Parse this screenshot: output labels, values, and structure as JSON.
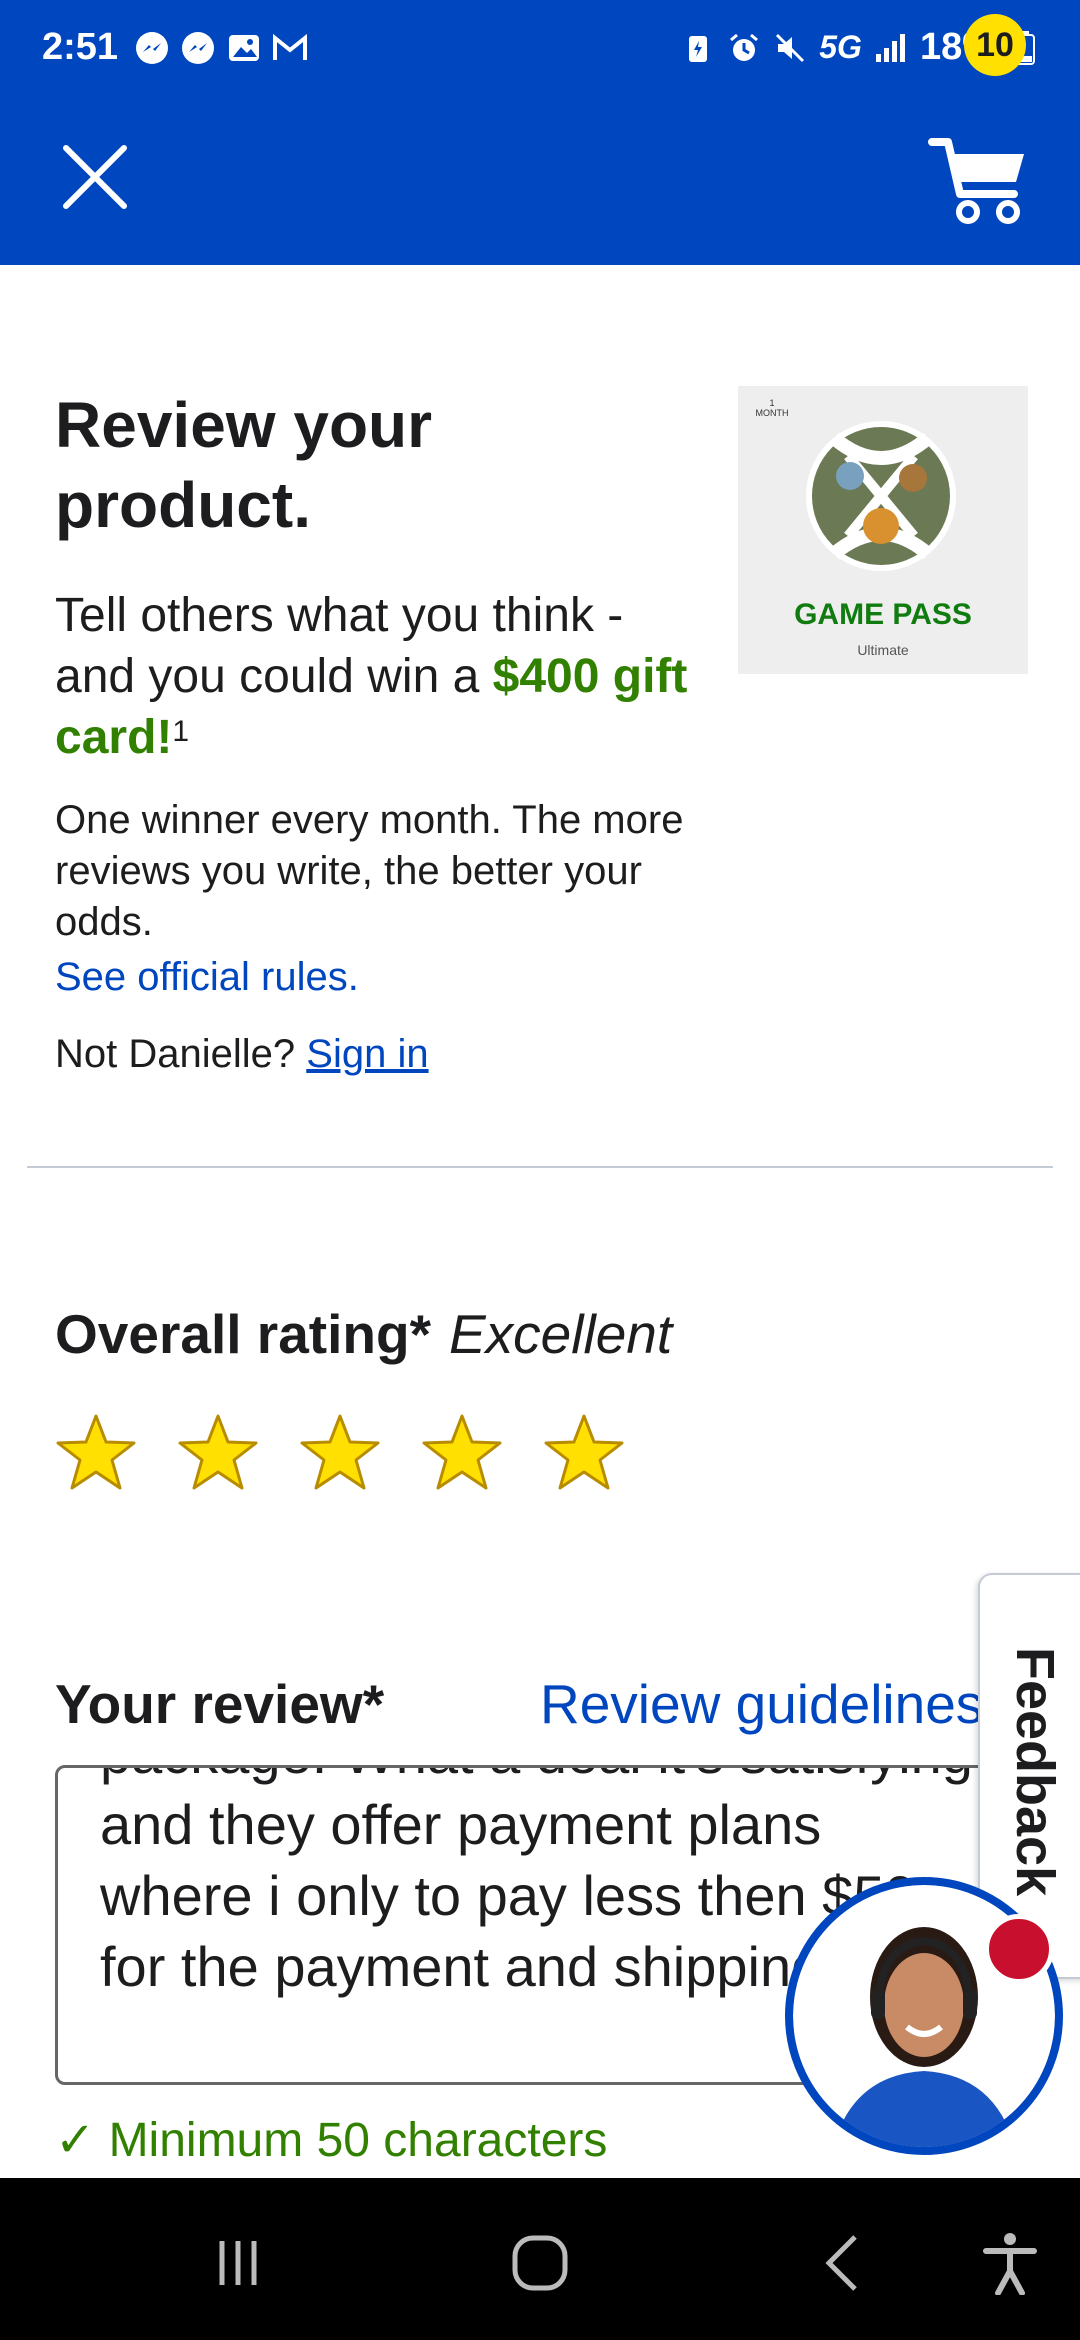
{
  "status_bar": {
    "time": "2:51",
    "notification_icons": [
      "messenger-icon",
      "messenger-icon",
      "gallery-icon",
      "gmail-icon"
    ],
    "system_icons": [
      "battery-saver-icon",
      "alarm-icon",
      "mute-icon",
      "5g-icon",
      "signal-icon"
    ],
    "network": "5G",
    "battery": "18%"
  },
  "app_bar": {
    "close_icon": "close-icon",
    "cart_icon": "cart-icon",
    "cart_count": "10"
  },
  "hero": {
    "title": "Review your product.",
    "subtitle_prefix": "Tell others what you think - and you could win a ",
    "subtitle_highlight": "$400 gift card!",
    "subtitle_sup": "1",
    "note": "One winner every month. The more reviews you write, the better your odds.",
    "rules_link": "See official rules.",
    "not_user_prefix": "Not Danielle?",
    "sign_in": "Sign in"
  },
  "product": {
    "image_top_label": "1 MONTH",
    "image_brand": "GAME PASS",
    "image_tier": "Ultimate"
  },
  "rating": {
    "label": "Overall rating*",
    "value_text": "Excellent",
    "stars": 5,
    "max_stars": 5,
    "star_color": "#ffe000"
  },
  "review": {
    "label": "Your review*",
    "guidelines_link": "Review guidelines",
    "text": "package. What a deal it's satisfying and they offer payment plans where i only to pay less then $50 for the payment and shipping was",
    "min_chars_hint": "Minimum 50 characters"
  },
  "feedback": {
    "tab_label": "Feedback"
  },
  "colors": {
    "brand_blue": "#0046be",
    "accent_green": "#318000",
    "badge_yellow": "#ffe000",
    "alert_red": "#c8102e"
  },
  "nav_bar": {
    "icons": [
      "recents-icon",
      "home-icon",
      "back-icon",
      "accessibility-icon"
    ]
  }
}
